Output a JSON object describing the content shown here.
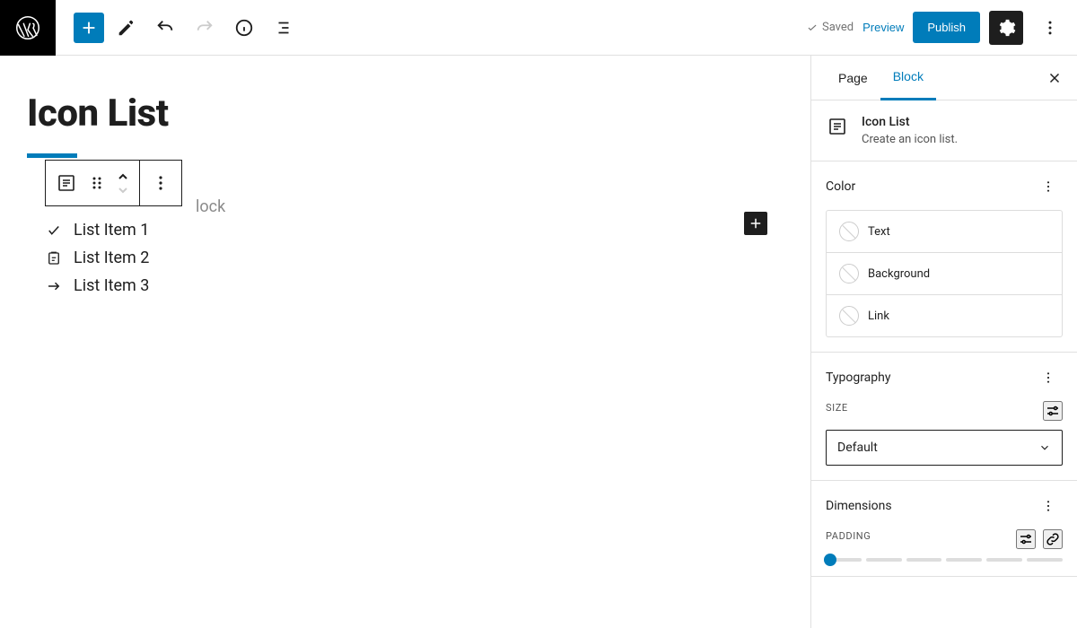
{
  "topbar": {
    "saved_label": "Saved",
    "preview_label": "Preview",
    "publish_label": "Publish"
  },
  "editor": {
    "page_title": "Icon List",
    "toolbar_placeholder": "lock",
    "list_items": [
      {
        "icon": "check",
        "text": "List Item 1"
      },
      {
        "icon": "assignment",
        "text": "List Item 2"
      },
      {
        "icon": "arrow",
        "text": "List Item 3"
      }
    ]
  },
  "sidebar": {
    "tabs": {
      "page": "Page",
      "block": "Block"
    },
    "block_info": {
      "title": "Icon List",
      "desc": "Create an icon list."
    },
    "color": {
      "heading": "Color",
      "items": [
        "Text",
        "Background",
        "Link"
      ]
    },
    "typography": {
      "heading": "Typography",
      "size_label": "Size",
      "size_value": "Default"
    },
    "dimensions": {
      "heading": "Dimensions",
      "padding_label": "Padding"
    }
  }
}
